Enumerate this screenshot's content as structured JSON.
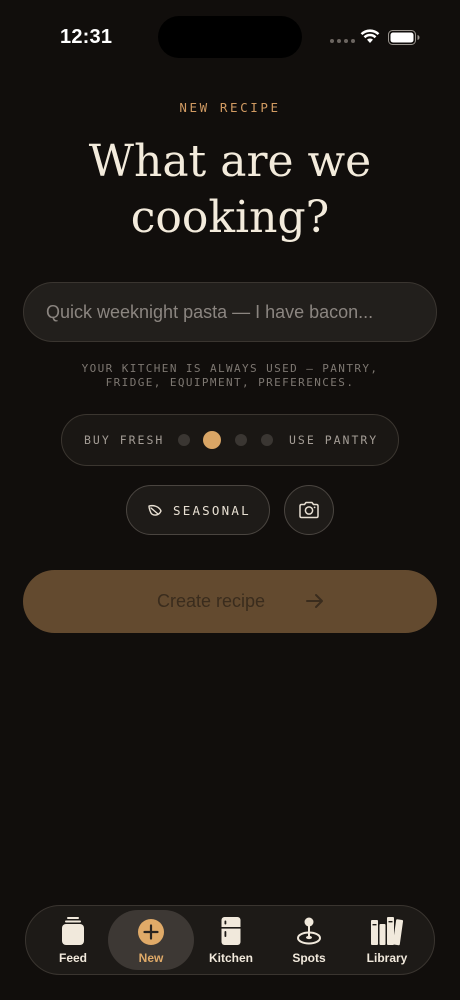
{
  "status_bar": {
    "time": "12:31"
  },
  "header": {
    "eyebrow": "NEW RECIPE",
    "title_line1": "What are we",
    "title_line2": "cooking?"
  },
  "prompt": {
    "placeholder": "Quick weeknight pasta — I have bacon...",
    "value": ""
  },
  "helper_text": "YOUR KITCHEN IS ALWAYS USED — PANTRY,\nFRIDGE, EQUIPMENT, PREFERENCES.",
  "source_slider": {
    "left_label": "BUY FRESH",
    "right_label": "USE PANTRY",
    "steps": 4,
    "selected_step": 2
  },
  "chips": {
    "seasonal_label": "SEASONAL",
    "seasonal_icon": "leaf-icon",
    "camera_icon": "camera-icon"
  },
  "cta": {
    "label": "Create recipe",
    "icon": "arrow-right-icon",
    "enabled": false
  },
  "tab_bar": {
    "active": "New",
    "items": [
      {
        "label": "Feed",
        "icon": "jar-icon"
      },
      {
        "label": "New",
        "icon": "plus-circle-icon"
      },
      {
        "label": "Kitchen",
        "icon": "fridge-icon"
      },
      {
        "label": "Spots",
        "icon": "map-pin-icon"
      },
      {
        "label": "Library",
        "icon": "books-icon"
      }
    ]
  },
  "colors": {
    "background": "#110e0c",
    "accent": "#d9a565",
    "cta_disabled": "#634a2f",
    "text_primary": "#f3ebdc"
  }
}
